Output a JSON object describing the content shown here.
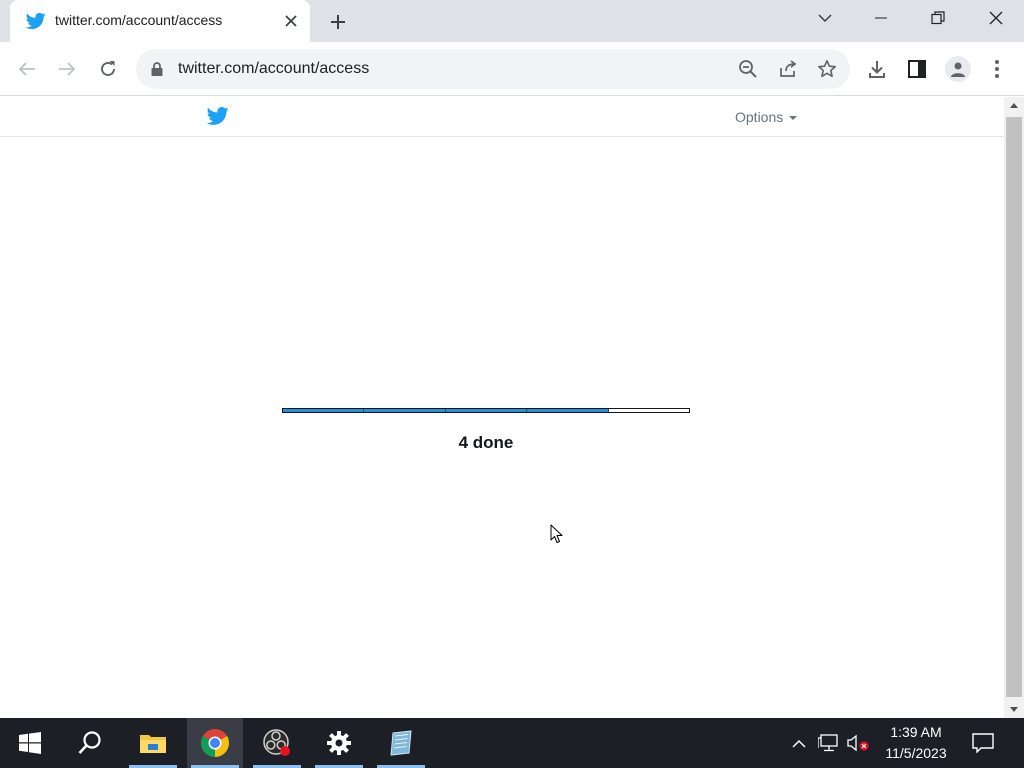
{
  "browser": {
    "tab": {
      "title": "twitter.com/account/access"
    },
    "address_bar": {
      "url": "twitter.com/account/access"
    }
  },
  "page": {
    "header": {
      "options_label": "Options"
    },
    "progress": {
      "segments_total": 5,
      "segments_done": 4,
      "status_text": "4 done"
    }
  },
  "taskbar": {
    "clock": {
      "time": "1:39 AM",
      "date": "11/5/2023"
    }
  },
  "colors": {
    "twitter_blue": "#1da1f2",
    "progress_fill": "#2a8fd6",
    "taskbar_bg": "#1c1f26"
  }
}
